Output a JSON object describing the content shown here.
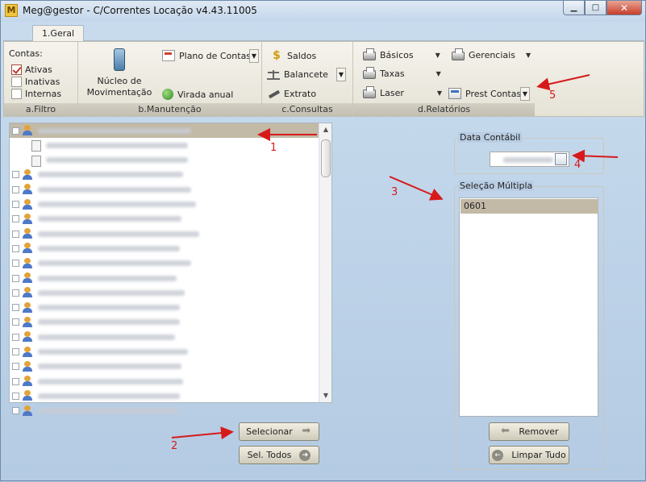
{
  "window": {
    "title": "Meg@gestor - C/Correntes Locação v4.43.11005",
    "app_icon_letter": "M",
    "minimize": "▁",
    "maximize": "□",
    "close": "✕"
  },
  "tabs": [
    {
      "label": "1.Geral"
    }
  ],
  "ribbon": {
    "filtro": {
      "title": "Contas:",
      "options": [
        {
          "label": "Ativas",
          "checked": true
        },
        {
          "label": "Inativas",
          "checked": false
        },
        {
          "label": "Internas",
          "checked": false
        }
      ],
      "group_label": "a.Filtro"
    },
    "manutencao": {
      "nucleo_label_1": "Núcleo de",
      "nucleo_label_2": "Movimentação",
      "plano": "Plano de Contas",
      "virada": "Virada anual",
      "group_label": "b.Manutenção"
    },
    "consultas": {
      "saldos": "Saldos",
      "balancete": "Balancete",
      "extrato": "Extrato",
      "group_label": "c.Consultas"
    },
    "relatorios": {
      "basicos": "Básicos",
      "gerenciais": "Gerenciais",
      "taxas": "Taxas",
      "laser": "Laser",
      "prest": "Prest Contas",
      "group_label": "d.Relatórios"
    }
  },
  "tree": {
    "rows": [
      {
        "type": "account",
        "selected": true,
        "expanded": true
      },
      {
        "type": "doc",
        "child": true
      },
      {
        "type": "doc",
        "child": true
      },
      {
        "type": "account"
      },
      {
        "type": "account"
      },
      {
        "type": "account"
      },
      {
        "type": "account"
      },
      {
        "type": "account"
      },
      {
        "type": "account"
      },
      {
        "type": "account"
      },
      {
        "type": "account"
      },
      {
        "type": "account"
      },
      {
        "type": "account"
      },
      {
        "type": "account"
      },
      {
        "type": "account"
      },
      {
        "type": "account"
      },
      {
        "type": "account"
      },
      {
        "type": "account"
      },
      {
        "type": "account"
      },
      {
        "type": "account"
      }
    ]
  },
  "buttons": {
    "selecionar": "Selecionar",
    "sel_todos": "Sel. Todos",
    "remover": "Remover",
    "limpar": "Limpar Tudo"
  },
  "data_contabil": {
    "label": "Data Contábil"
  },
  "selecao": {
    "label": "Seleção Múltipla",
    "items": [
      "0601"
    ]
  },
  "annotations": [
    "1",
    "2",
    "3",
    "4",
    "5"
  ],
  "colors": {
    "annotation": "#d61a1a",
    "selected_row": "#c2b9a6"
  }
}
